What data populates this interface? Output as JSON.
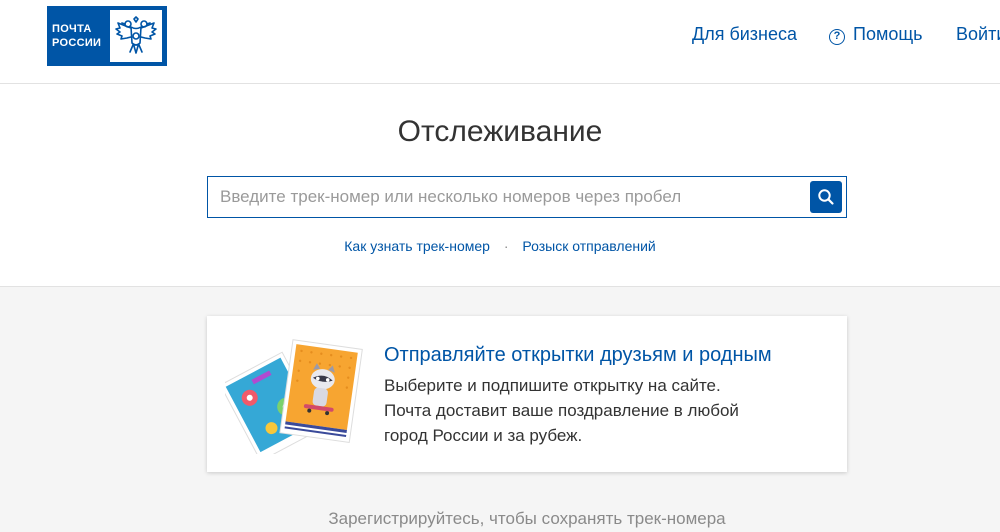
{
  "header": {
    "logo": {
      "line1": "ПОЧТА",
      "line2": "РОССИИ"
    },
    "nav": {
      "business": "Для бизнеса",
      "help": "Помощь",
      "login": "Войти"
    }
  },
  "tracking": {
    "title": "Отслеживание",
    "search": {
      "placeholder": "Введите трек-номер или несколько номеров через пробел",
      "value": ""
    },
    "links": {
      "how_to": "Как узнать трек-номер",
      "separator": "·",
      "search_shipments": "Розыск отправлений"
    }
  },
  "promo": {
    "title": "Отправляйте открытки друзьям и родным",
    "lines": [
      "Выберите и подпишите открытку на сайте.",
      "Почта доставит ваше поздравление в любой",
      "город России и за рубеж."
    ]
  },
  "footer_note": "Зарегистрируйтесь, чтобы сохранять трек-номера",
  "icons": {
    "emblem": "double-headed-eagle-icon",
    "help": "question-circle-icon",
    "search": "magnifier-icon"
  },
  "colors": {
    "brand_blue": "#0055a6",
    "page_bg": "#f5f5f5",
    "muted_text": "#8a8a8a"
  }
}
